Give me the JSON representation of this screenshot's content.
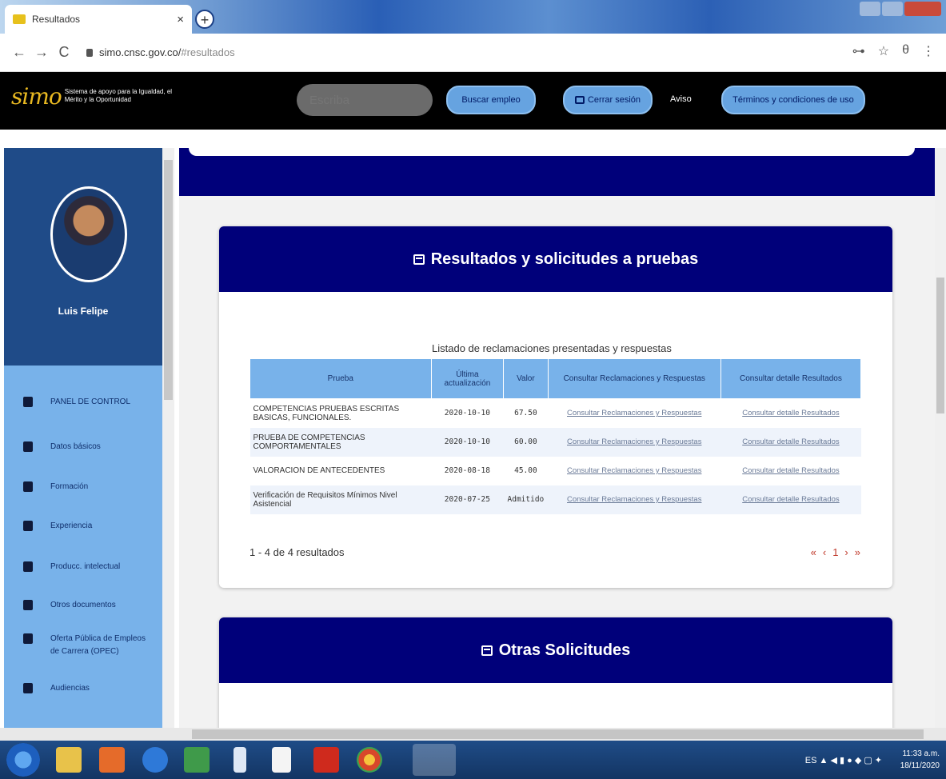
{
  "browser": {
    "tab_title": "Resultados",
    "tab_close": "×",
    "new_tab": "+",
    "back": "←",
    "forward": "→",
    "reload": "C",
    "url_host": "simo.cnsc.gov.co/",
    "url_hash": "#resultados",
    "key_icon": "⊶",
    "star": "☆",
    "account": "θ",
    "menu": "⋮"
  },
  "site_header": {
    "logo_mark": "simo",
    "logo_text": "Sistema de apoyo para la Igualdad, el Mérito y la Oportunidad",
    "search_placeholder": "Escriba",
    "buscar_label": "Buscar empleo",
    "cerrar_label": "Cerrar sesión",
    "aviso_label": "Aviso",
    "terminos_label": "Términos y condiciones de uso"
  },
  "sidebar": {
    "user_name": "Luis Felipe",
    "items": [
      {
        "label": "PANEL DE CONTROL",
        "icon": "dashboard-icon"
      },
      {
        "label": "Datos básicos",
        "icon": "users-icon"
      },
      {
        "label": "Formación",
        "icon": "graduate-icon"
      },
      {
        "label": "Experiencia",
        "icon": "briefcase-icon"
      },
      {
        "label": "Producc. intelectual",
        "icon": "book-icon"
      },
      {
        "label": "Otros documentos",
        "icon": "file-icon"
      },
      {
        "label": "Oferta Pública de Empleos de Carrera (OPEC)",
        "icon": "globe-icon"
      },
      {
        "label": "Audiencias",
        "icon": "audience-icon"
      }
    ]
  },
  "results_card": {
    "title": "Resultados y solicitudes a pruebas",
    "caption": "Listado de reclamaciones presentadas y respuestas",
    "columns": [
      "Prueba",
      "Última actualización",
      "Valor",
      "Consultar Reclamaciones y Respuestas",
      "Consultar detalle Resultados"
    ],
    "rows": [
      {
        "prueba": "COMPETENCIAS PRUEBAS ESCRITAS BASICAS, FUNCIONALES.",
        "fecha": "2020-10-10",
        "valor": "67.50",
        "reclamaciones": "Consultar Reclamaciones y Respuestas",
        "detalle": "Consultar detalle Resultados"
      },
      {
        "prueba": "PRUEBA DE COMPETENCIAS COMPORTAMENTALES",
        "fecha": "2020-10-10",
        "valor": "60.00",
        "reclamaciones": "Consultar Reclamaciones y Respuestas",
        "detalle": "Consultar detalle Resultados"
      },
      {
        "prueba": "VALORACION DE ANTECEDENTES",
        "fecha": "2020-08-18",
        "valor": "45.00",
        "reclamaciones": "Consultar Reclamaciones y Respuestas",
        "detalle": "Consultar detalle Resultados"
      },
      {
        "prueba": "Verificación de Requisitos Mínimos Nivel Asistencial",
        "fecha": "2020-07-25",
        "valor": "Admitido",
        "reclamaciones": "Consultar Reclamaciones y Respuestas",
        "detalle": "Consultar detalle Resultados"
      }
    ],
    "pagination_info": "1 - 4 de 4 resultados",
    "pager": {
      "first": "«",
      "prev": "‹",
      "page": "1",
      "next": "›",
      "last": "»"
    }
  },
  "other_card": {
    "title": "Otras Solicitudes"
  },
  "taskbar": {
    "lang": "ES",
    "time": "11:33 a.m.",
    "date": "18/11/2020"
  },
  "colors": {
    "navy": "#00007a",
    "sidebar_dark": "#1f4b88",
    "sidebar_light": "#78b2ea",
    "link": "#6b7b98",
    "pager_red": "#c0392b"
  }
}
